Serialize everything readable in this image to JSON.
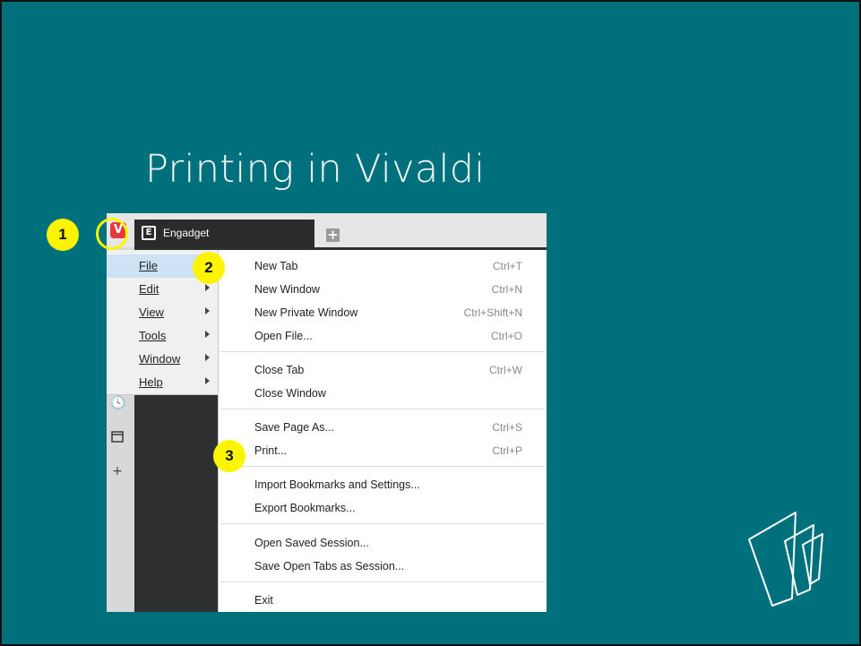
{
  "slide": {
    "title": "Printing in Vivaldi",
    "background_color": "#00717c",
    "callout_color": "#fcf400"
  },
  "browser": {
    "logo_letter": "V",
    "tab_label": "Engadget",
    "tab_icon_letter": "E",
    "new_tab_symbol": "+",
    "side_icons": [
      "clock-icon",
      "window-icon",
      "plus-icon"
    ]
  },
  "main_menu": {
    "items": [
      {
        "label": "File",
        "has_submenu": false,
        "active": true
      },
      {
        "label": "Edit",
        "has_submenu": true
      },
      {
        "label": "View",
        "has_submenu": true
      },
      {
        "label": "Tools",
        "has_submenu": true
      },
      {
        "label": "Window",
        "has_submenu": true
      },
      {
        "label": "Help",
        "has_submenu": true
      }
    ]
  },
  "file_menu": {
    "items": [
      {
        "label": "New Tab",
        "shortcut": "Ctrl+T"
      },
      {
        "label": "New Window",
        "shortcut": "Ctrl+N"
      },
      {
        "label": "New Private Window",
        "shortcut": "Ctrl+Shift+N"
      },
      {
        "label": "Open File...",
        "shortcut": "Ctrl+O"
      },
      {
        "label": "Close Tab",
        "shortcut": "Ctrl+W"
      },
      {
        "label": "Close Window",
        "shortcut": ""
      },
      {
        "label": "Save Page As...",
        "shortcut": "Ctrl+S"
      },
      {
        "label": "Print...",
        "shortcut": "Ctrl+P"
      },
      {
        "label": "Import Bookmarks and Settings...",
        "shortcut": ""
      },
      {
        "label": "Export Bookmarks...",
        "shortcut": ""
      },
      {
        "label": "Open Saved Session...",
        "shortcut": ""
      },
      {
        "label": "Save Open Tabs as Session...",
        "shortcut": ""
      },
      {
        "label": "Exit",
        "shortcut": ""
      }
    ]
  },
  "callouts": [
    "1",
    "2",
    "3"
  ]
}
